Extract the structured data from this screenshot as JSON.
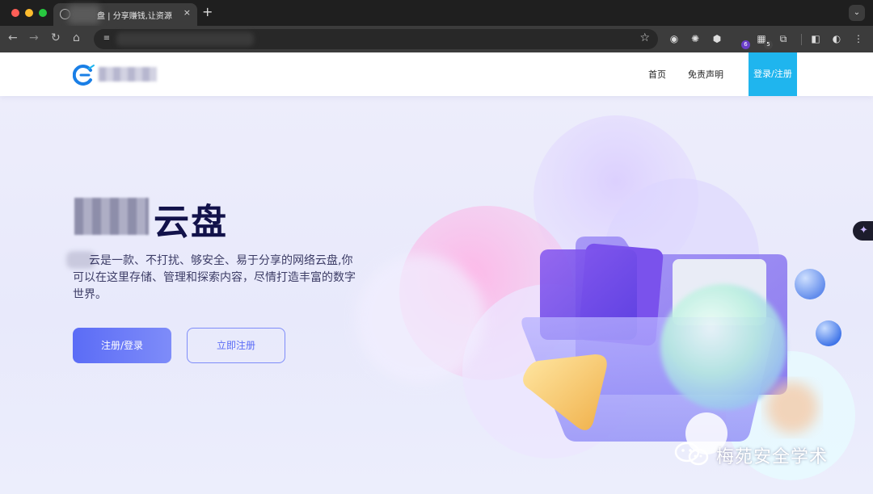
{
  "browser": {
    "tab_title": "盘 | 分享赚钱,让资源",
    "tab_close": "×",
    "new_tab": "+",
    "tab_search": "⌄",
    "back": "←",
    "forward": "→",
    "reload": "↻",
    "home": "⌂",
    "bookmark": "☆",
    "extension_badges": [
      "6",
      "5"
    ],
    "site_info_icon": "tune-icon"
  },
  "site": {
    "nav": {
      "home": "首页",
      "disclaimer": "免责声明",
      "login": "登录/注册"
    },
    "hero": {
      "title": "云盘",
      "description": "云是一款、不打扰、够安全、易于分享的网络云盘,你可以在这里存储、管理和探索内容，尽情打造丰富的数字世界。",
      "primary_button": "注册/登录",
      "secondary_button": "立即注册"
    },
    "accent": "#5b6cf6",
    "login_bg": "#1fb5ee"
  },
  "watermark": {
    "text": "梅苑安全学术"
  }
}
